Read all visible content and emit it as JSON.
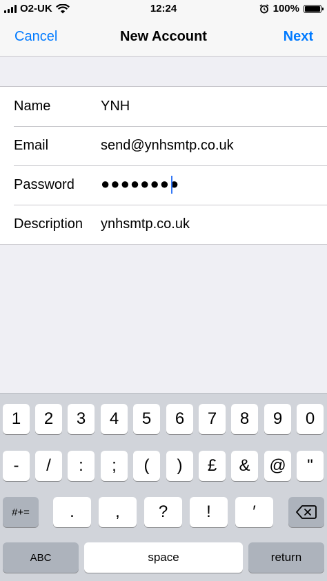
{
  "status_bar": {
    "carrier": "O2-UK",
    "time": "12:24",
    "battery": "100%",
    "battery_level": 1.0
  },
  "nav": {
    "cancel_label": "Cancel",
    "title": "New Account",
    "next_label": "Next"
  },
  "form": {
    "rows": [
      {
        "label": "Name",
        "value": "YNH"
      },
      {
        "label": "Email",
        "value": "send@ynhsmtp.co.uk"
      },
      {
        "label": "Password",
        "value": "●●●●●●●●"
      },
      {
        "label": "Description",
        "value": "ynhsmtp.co.uk"
      }
    ]
  },
  "keyboard": {
    "row1": [
      "1",
      "2",
      "3",
      "4",
      "5",
      "6",
      "7",
      "8",
      "9",
      "0"
    ],
    "row2": [
      "-",
      "/",
      ":",
      ";",
      "(",
      ")",
      "£",
      "&",
      "@",
      "\""
    ],
    "row3": {
      "symbols": "#+=",
      "keys": [
        ".",
        ",",
        "?",
        "!",
        "′"
      ],
      "delete_icon": "backspace-icon"
    },
    "row4": {
      "abc": "ABC",
      "space": "space",
      "return": "return"
    }
  },
  "colors": {
    "accent": "#007aff",
    "cursor": "#3478f6",
    "background": "#efeff4",
    "keyboard": "#d1d4da"
  }
}
